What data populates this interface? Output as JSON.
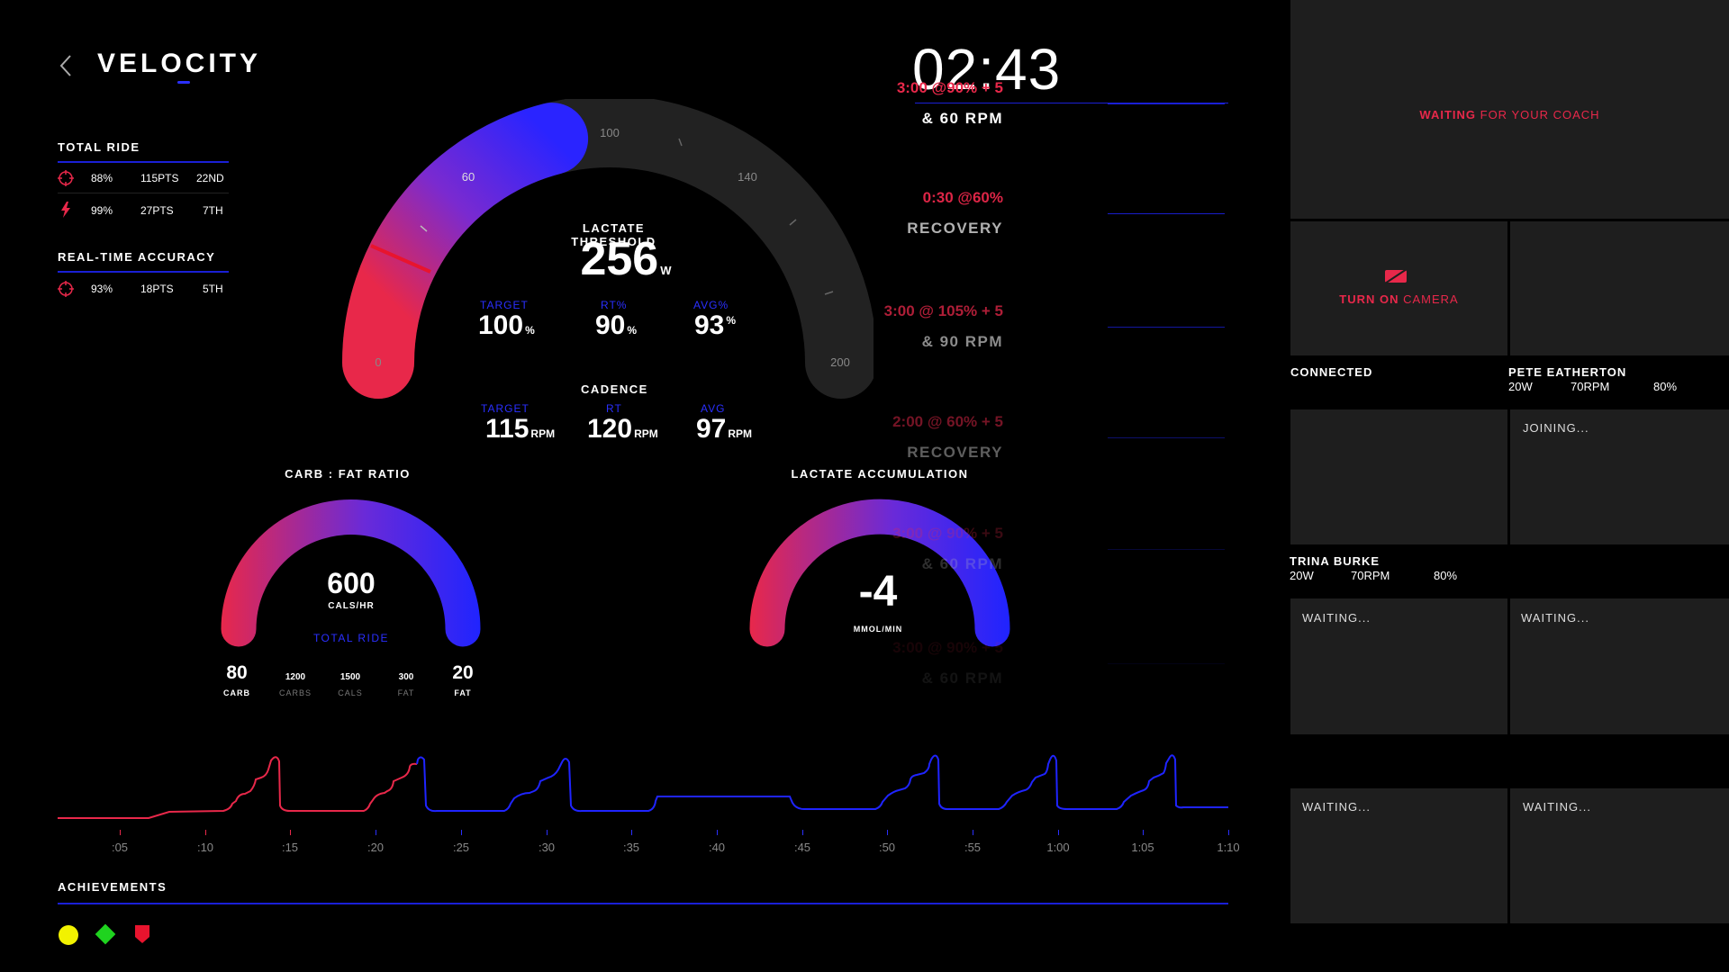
{
  "brand": {
    "name": "VELOCITY"
  },
  "timer": "02:43",
  "total_ride": {
    "title": "TOTAL RIDE",
    "rows": [
      {
        "icon": "target-icon",
        "pct": "88%",
        "pts": "115PTS",
        "rank": "22ND"
      },
      {
        "icon": "lightning-icon",
        "pct": "99%",
        "pts": "27PTS",
        "rank": "7TH"
      }
    ]
  },
  "realtime": {
    "title": "REAL-TIME ACCURACY",
    "rows": [
      {
        "icon": "target-icon",
        "pct": "93%",
        "pts": "18PTS",
        "rank": "5TH"
      }
    ]
  },
  "main_gauge": {
    "scale_labels": [
      "0",
      "60",
      "100",
      "140",
      "200"
    ],
    "title": "LACTATE THRESHOLD",
    "value": "256",
    "unit": "W",
    "power_value": 84,
    "metrics": [
      {
        "label": "TARGET",
        "value": "100",
        "unit": "%"
      },
      {
        "label": "RT%",
        "value": "90",
        "unit": "%"
      },
      {
        "label": "AVG%",
        "value": "93",
        "unit": "%"
      }
    ],
    "cadence_title": "CADENCE",
    "cadence": [
      {
        "label": "TARGET",
        "value": "115",
        "unit": "RPM"
      },
      {
        "label": "RT",
        "value": "120",
        "unit": "RPM"
      },
      {
        "label": "AVG",
        "value": "97",
        "unit": "RPM"
      }
    ]
  },
  "carb_fat": {
    "title": "CARB : FAT RATIO",
    "value": "600",
    "unit": "CALS/HR",
    "sub": "TOTAL RIDE",
    "carb": {
      "value": "80",
      "label": "CARB"
    },
    "fat": {
      "value": "20",
      "label": "FAT"
    },
    "carbs": {
      "value": "1200",
      "label": "CARBS"
    },
    "cals": {
      "value": "1500",
      "label": "CALS"
    },
    "fat_small": {
      "value": "300",
      "label": "FAT"
    }
  },
  "lactate": {
    "title": "LACTATE ACCUMULATION",
    "value": "-4",
    "unit": "MMOL/MIN"
  },
  "intervals": [
    {
      "line1": "3:00 @90% + 5",
      "line2": "& 60 RPM",
      "opacity": 1.0
    },
    {
      "line1": "0:30 @60%",
      "line2": "RECOVERY",
      "opacity": 0.95
    },
    {
      "line1": "3:00 @ 105% + 5",
      "line2": "& 90 RPM",
      "opacity": 0.75
    },
    {
      "line1": "2:00 @ 60% + 5",
      "line2": "RECOVERY",
      "opacity": 0.5
    },
    {
      "line1": "3:00 @ 90% + 5",
      "line2": "& 60 RPM",
      "opacity": 0.25
    },
    {
      "line1": "3:00 @ 90% + 5",
      "line2": "& 60 RPM",
      "opacity": 0.1
    }
  ],
  "timeline": {
    "ticks": [
      ":05",
      ":10",
      ":15",
      ":20",
      ":25",
      ":30",
      ":35",
      ":40",
      ":45",
      ":50",
      ":55",
      "1:00",
      "1:05",
      "1:10"
    ]
  },
  "achievements": {
    "title": "ACHIEVEMENTS",
    "badges": [
      {
        "icon": "yellow-circle-icon",
        "color": "#f2f200"
      },
      {
        "icon": "green-diamond-icon",
        "color": "#1fd31f"
      },
      {
        "icon": "red-shield-icon",
        "color": "#e8142e"
      }
    ]
  },
  "video": {
    "coach": {
      "waiting_highlight": "WAITING",
      "waiting_rest": " FOR YOUR COACH"
    },
    "camera": {
      "highlight": "TURN ON",
      "rest": " CAMERA"
    },
    "connected": "CONNECTED",
    "pete": {
      "name": "PETE EATHERTON",
      "watts": "20W",
      "rpm": "70RPM",
      "pct": "80%"
    },
    "trina": {
      "name": "TRINA BURKE",
      "watts": "20W",
      "rpm": "70RPM",
      "pct": "80%"
    },
    "joining": "JOINING...",
    "waiting": "WAITING..."
  },
  "colors": {
    "red": "#e8284a",
    "blue": "#1f24ff",
    "gauge_track": "#222222",
    "tile": "#1e1e1e"
  }
}
